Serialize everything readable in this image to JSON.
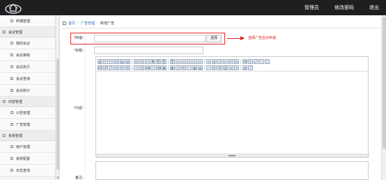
{
  "header": {
    "nav": [
      "管理员",
      "修改密码",
      "退出"
    ]
  },
  "sidebar": {
    "sections": [
      {
        "type": "item",
        "label": "终端管理"
      },
      {
        "type": "group",
        "label": "会议管理"
      },
      {
        "type": "item",
        "label": "我的会议"
      },
      {
        "type": "item",
        "label": "会议审核"
      },
      {
        "type": "item",
        "label": "会议执行"
      },
      {
        "type": "item",
        "label": "会议查询"
      },
      {
        "type": "item",
        "label": "会议统计"
      },
      {
        "type": "group",
        "label": "内容管理"
      },
      {
        "type": "item",
        "label": "公告管理"
      },
      {
        "type": "item",
        "label": "广告管理"
      },
      {
        "type": "group",
        "label": "系统管理"
      },
      {
        "type": "item",
        "label": "用户管理"
      },
      {
        "type": "item",
        "label": "系统配置"
      },
      {
        "type": "item",
        "label": "日志查询"
      }
    ]
  },
  "breadcrumb": {
    "home": "首页",
    "section": "广告管理",
    "current": "新增广告"
  },
  "form": {
    "terminal_label": "终端：",
    "select_button": "选择",
    "annotation": "选择广告显示终端",
    "title_label": "标题：",
    "content_label": "内容：",
    "remark_label": "备注：",
    "required_mark": "*"
  },
  "editor": {
    "row1": [
      "⎙",
      "↶",
      "↷",
      "🔗",
      "▤",
      "▤",
      "⊡",
      "⊡",
      "✂",
      "⧉",
      "⎘",
      "⎘",
      "⎘",
      "≡",
      "≡",
      "≡",
      "≡",
      "≡",
      "≡",
      "≣",
      "⇥",
      "⇤",
      "x²",
      "x₂",
      "⌫",
      "✎",
      "⤢",
      "⛶",
      "⛶"
    ],
    "row2": [
      "H1",
      "𝒯",
      "T",
      "A",
      "A",
      "B",
      "I",
      "U",
      "abc",
      "I",
      "⌫",
      "▦",
      "▦",
      "♫",
      "✉",
      "⛶",
      "▦",
      "▤",
      "─",
      "☺",
      "Ω",
      "⎙",
      "⇲",
      "⚓",
      "@",
      "?"
    ]
  }
}
